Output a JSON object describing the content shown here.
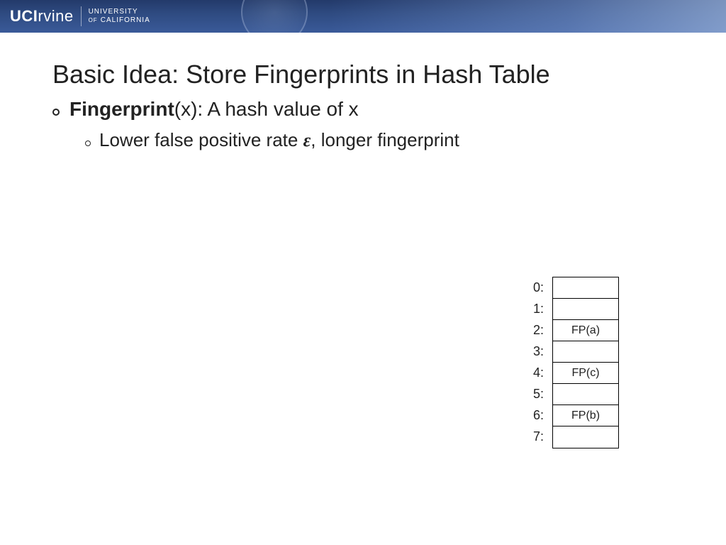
{
  "header": {
    "logo_bold": "UCI",
    "logo_light": "rvine",
    "sub_line1": "UNIVERSITY",
    "sub_line2_of": "of ",
    "sub_line2_cal": "CALIFORNIA"
  },
  "title": "Basic Idea: Store Fingerprints in Hash Table",
  "bullet1_strong": "Fingerprint",
  "bullet1_rest": "(x): A hash value of x",
  "bullet2_pre": "Lower false positive rate ",
  "bullet2_eps": "ε",
  "bullet2_post": ", longer fingerprint",
  "hash": {
    "labels": [
      "0:",
      "1:",
      "2:",
      "3:",
      "4:",
      "5:",
      "6:",
      "7:"
    ],
    "cells": [
      "",
      "",
      "FP(a)",
      "",
      "FP(c)",
      "",
      "FP(b)",
      ""
    ]
  }
}
